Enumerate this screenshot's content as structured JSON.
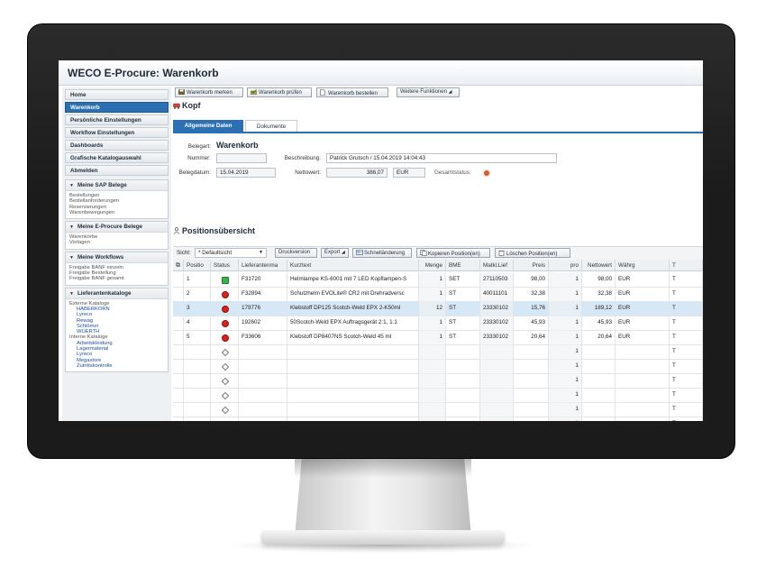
{
  "app_title": "WECO E-Procure: Warenkorb",
  "sidebar": {
    "nav": [
      {
        "label": "Home",
        "active": false
      },
      {
        "label": "Warenkorb",
        "active": true
      },
      {
        "label": "Persönliche Einstellungen",
        "active": false
      },
      {
        "label": "Workflow Einstellungen",
        "active": false
      },
      {
        "label": "Dashboards",
        "active": false
      },
      {
        "label": "Grafische Katalogauswahl",
        "active": false
      },
      {
        "label": "Abmelden",
        "active": false
      }
    ],
    "panels": [
      {
        "title": "Meine SAP Belege",
        "items": [
          "Bestellungen",
          "Bestellanforderungen",
          "Reservierungen",
          "Warenbewegungen"
        ]
      },
      {
        "title": "Meine E-Procure Belege",
        "items": [
          "Warenkörbe",
          "Vorlagen"
        ]
      },
      {
        "title": "Meine Workflows",
        "items": [
          "Freigabe BANF einzeln",
          "Freigabe Bestellung",
          "Freigabe BANF gesamt"
        ]
      },
      {
        "title": "Lieferantenkataloge",
        "groups": [
          {
            "heading": "Externe Kataloge",
            "links": [
              "HABERKORN",
              "Lyreco",
              "Rewag",
              "Schlömer",
              "WUERTH"
            ]
          },
          {
            "heading": "Interne Kataloge",
            "links": [
              "Arbeitskleidung",
              "Lagermaterial",
              "Lyreco",
              "Megastore",
              "Zutrittskontrolle"
            ]
          }
        ]
      }
    ]
  },
  "toolbar": {
    "buttons": [
      "Warenkorb merken",
      "Warenkorb prüfen",
      "Warenkorb bestellen",
      "Weitere Funktionen"
    ]
  },
  "kopf": {
    "title": "Kopf",
    "tabs": [
      "Allgemeine Daten",
      "Dokumente"
    ],
    "belegart_label": "Belegart:",
    "belegart_value": "Warenkorb",
    "nummer_label": "Nummer:",
    "nummer_value": "",
    "beschreibung_label": "Beschreibung:",
    "beschreibung_value": "Patrick Grutsch / 15.04.2019 14:04:43",
    "belegdatum_label": "Belegdatum:",
    "belegdatum_value": "15.04.2019",
    "nettowert_label": "Nettowert:",
    "nettowert_value": "386,07",
    "currency": "EUR",
    "gesamtstatus_label": "Gesamtstatus:",
    "status_color": "#e4572e"
  },
  "positionen": {
    "title": "Positionsübersicht",
    "sicht_label": "Sicht:",
    "sicht_value": "* Defaultsicht",
    "toolbar": [
      "Druckversion",
      "Export",
      "Schnelländerung",
      "Kopieren Position(en)",
      "Löschen Position(en)"
    ],
    "columns": [
      "Positio",
      "Status",
      "Lieferantenma",
      "Kurztext",
      "Menge",
      "BME",
      "Matkl.Lief",
      "Preis",
      "pro",
      "Nettowert",
      "Währg",
      "T"
    ],
    "rows": [
      {
        "pos": "1",
        "status": "green",
        "lief": "F31720",
        "text": "Helmlampe KS-6001 mit 7 LED Kopflampen-S",
        "menge": "1",
        "bme": "SET",
        "matkl": "27110503",
        "preis": "98,00",
        "pro": "1",
        "netto": "98,00",
        "waehrg": "EUR",
        "t": "T",
        "selected": false
      },
      {
        "pos": "2",
        "status": "red",
        "lief": "F32894",
        "text": "Schutzhelm EVOLite® CR2 mit Drehradversc",
        "menge": "1",
        "bme": "ST",
        "matkl": "40011101",
        "preis": "32,38",
        "pro": "1",
        "netto": "32,38",
        "waehrg": "EUR",
        "t": "T",
        "selected": false
      },
      {
        "pos": "3",
        "status": "red",
        "lief": "179776",
        "text": "Klebstoff DP125 Scotch-Weld EPX 2-K50ml",
        "menge": "12",
        "bme": "ST",
        "matkl": "23330102",
        "preis": "15,76",
        "pro": "1",
        "netto": "189,12",
        "waehrg": "EUR",
        "t": "T",
        "selected": true
      },
      {
        "pos": "4",
        "status": "red",
        "lief": "192602",
        "text": "50Scotch-Weld EPX Auftragsgerät 2:1, 1:1",
        "menge": "1",
        "bme": "ST",
        "matkl": "23330102",
        "preis": "45,93",
        "pro": "1",
        "netto": "45,93",
        "waehrg": "EUR",
        "t": "T",
        "selected": false
      },
      {
        "pos": "5",
        "status": "red",
        "lief": "F33606",
        "text": "Klebstoff DP8407NS Scotch-Weld 45 ml",
        "menge": "1",
        "bme": "ST",
        "matkl": "23330102",
        "preis": "20,64",
        "pro": "1",
        "netto": "20,64",
        "waehrg": "EUR",
        "t": "T",
        "selected": false
      }
    ],
    "empty_rows": [
      {
        "pro": "1",
        "t": "T"
      },
      {
        "pro": "1",
        "t": "T"
      },
      {
        "pro": "1",
        "t": "T"
      },
      {
        "pro": "1",
        "t": "T"
      },
      {
        "pro": "1",
        "t": "T"
      },
      {
        "pro": "1",
        "t": "T"
      },
      {
        "pro": "1",
        "t": "T"
      },
      {
        "pro": "1",
        "t": "T"
      }
    ]
  }
}
